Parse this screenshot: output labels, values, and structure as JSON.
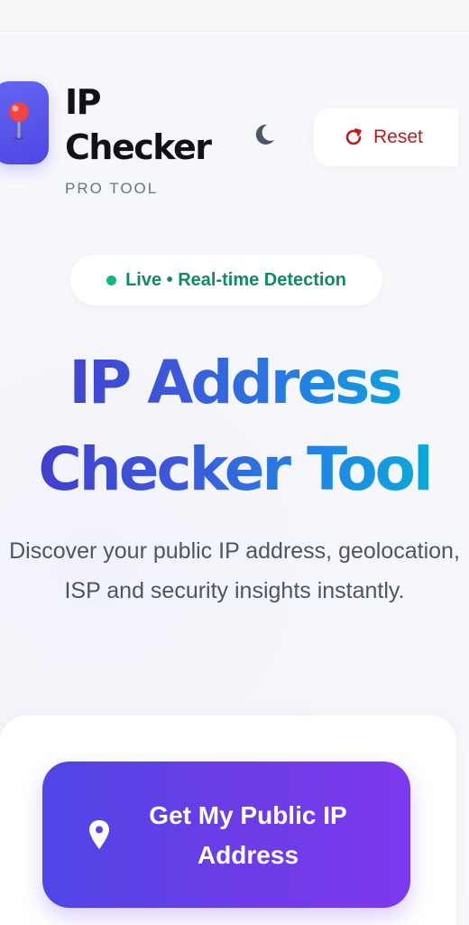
{
  "header": {
    "brand_title": "IP Checker",
    "brand_subtitle": "PRO TOOL",
    "logo_icon": "map-pin-icon",
    "theme_toggle_icon": "moon-icon",
    "reset_label": "Reset",
    "reset_icon": "refresh-icon"
  },
  "badge": {
    "text": "Live • Real-time Detection",
    "dot_color": "#10b981"
  },
  "hero": {
    "title": "IP Address Checker Tool",
    "description": "Discover your public IP address, geolocation, ISP and security insights instantly."
  },
  "cta": {
    "label": "Get My Public IP Address",
    "icon": "location-pin-icon"
  },
  "colors": {
    "accent_start": "#4f46e5",
    "accent_end": "#7c3aed",
    "reset_red": "#b91c1c",
    "live_green": "#0f8a63"
  }
}
